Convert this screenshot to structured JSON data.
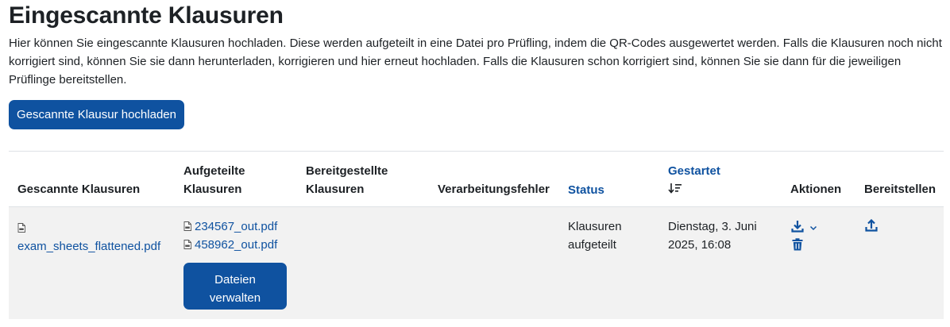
{
  "page": {
    "title": "Eingescannte Klausuren",
    "intro": "Hier können Sie eingescannte Klausuren hochladen. Diese werden aufgeteilt in eine Datei pro Prüfling, indem die QR-Codes ausgewertet werden. Falls die Klausuren noch nicht korrigiert sind, können Sie sie dann herunterladen, korrigieren und hier erneut hochladen. Falls die Klausuren schon korrigiert sind, können Sie sie dann für die jeweiligen Prüflinge bereitstellen.",
    "upload_button": "Gescannte Klausur hochladen"
  },
  "table": {
    "headers": {
      "scanned": "Gescannte Klausuren",
      "split_line1": "Aufgeteilte",
      "split_line2": "Klausuren",
      "provided_line1": "Bereitgestellte",
      "provided_line2": "Klausuren",
      "errors": "Verarbeitungsfehler",
      "status": "Status",
      "started": "Gestartet",
      "actions": "Aktionen",
      "publish": "Bereitstellen"
    },
    "rows": [
      {
        "scanned_file": "exam_sheets_flattened.pdf",
        "split_files": [
          "234567_out.pdf",
          "458962_out.pdf"
        ],
        "manage_button_line1": "Dateien",
        "manage_button_line2": "verwalten",
        "status_line1": "Klausuren",
        "status_line2": "aufgeteilt",
        "started_line1": "Dienstag, 3. Juni",
        "started_line2": "2025, 16:08"
      }
    ]
  },
  "icons": {
    "file": "pdf-file-icon",
    "sort": "sort-descending-icon",
    "download": "download-icon",
    "dropdown": "chevron-down-icon",
    "delete": "trash-icon",
    "upload": "upload-icon"
  },
  "colors": {
    "accent": "#0f52a0",
    "row_background": "#f2f2f2",
    "border": "#dee2e6",
    "text": "#1d2125"
  }
}
